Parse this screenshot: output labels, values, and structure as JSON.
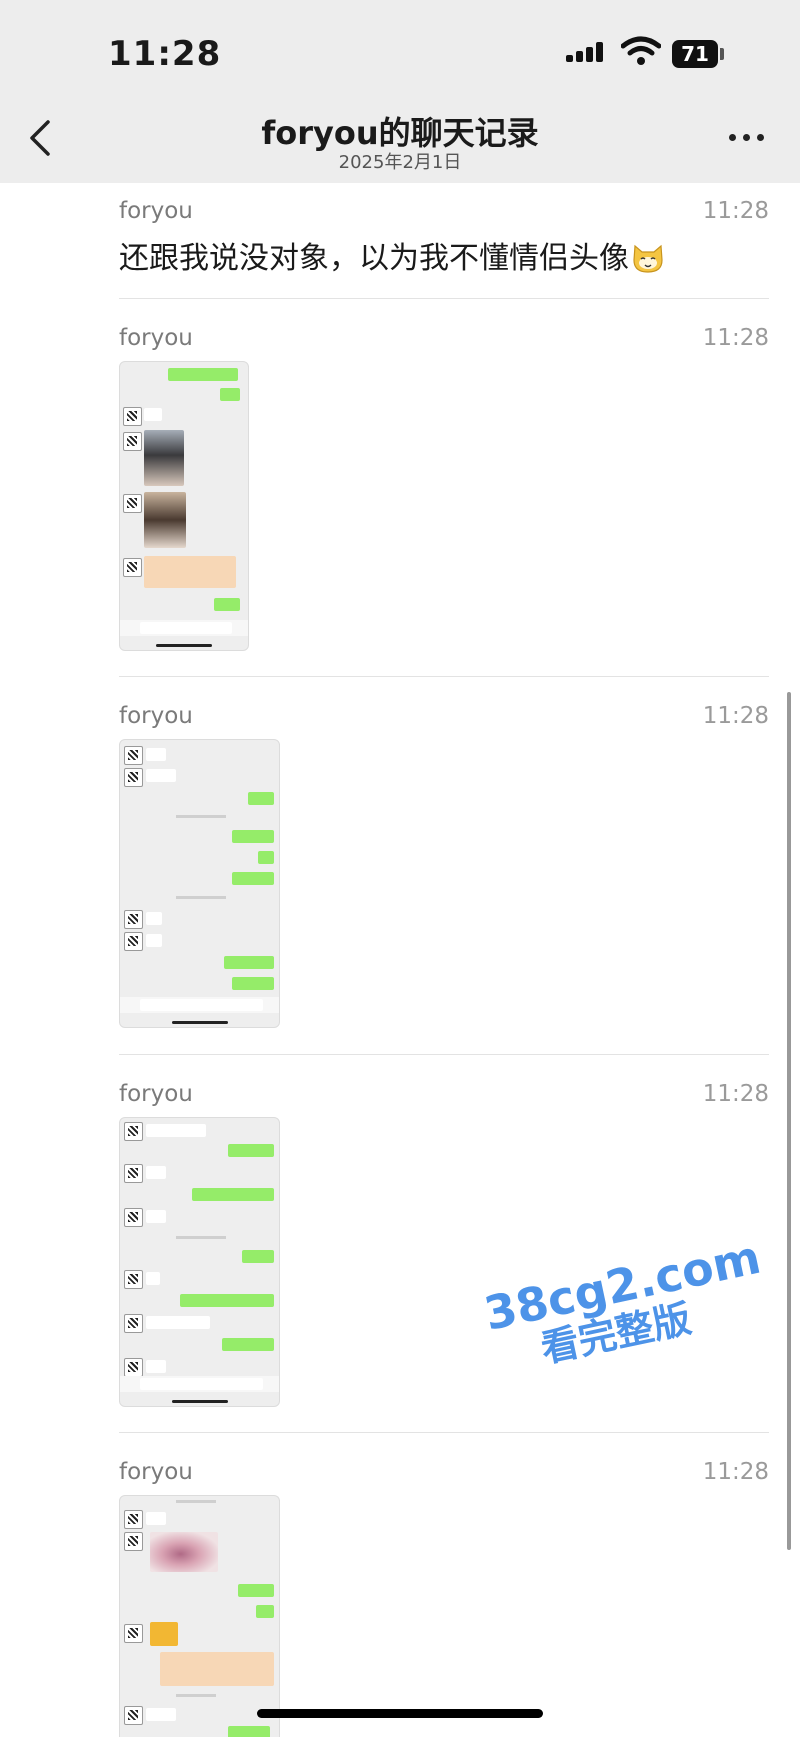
{
  "status_bar": {
    "time": "11:28",
    "battery": "71"
  },
  "nav": {
    "title": "foryou的聊天记录",
    "date": "2025年2月1日"
  },
  "messages": [
    {
      "sender": "foryou",
      "time": "11:28",
      "text": "还跟我说没对象，以为我不懂情侣头像"
    },
    {
      "sender": "foryou",
      "time": "11:28"
    },
    {
      "sender": "foryou",
      "time": "11:28"
    },
    {
      "sender": "foryou",
      "time": "11:28"
    },
    {
      "sender": "foryou",
      "time": "11:28"
    }
  ],
  "watermark": {
    "line1": "38cg2.com",
    "line2": "看完整版"
  },
  "icons": {
    "back": "chevron-left-icon",
    "more": "more-dots-icon",
    "emoji": "cat-face-emoji-icon"
  },
  "colors": {
    "nav_bg": "#ededed",
    "bubble_green": "#95ec69",
    "watermark": "#4d93e8"
  }
}
